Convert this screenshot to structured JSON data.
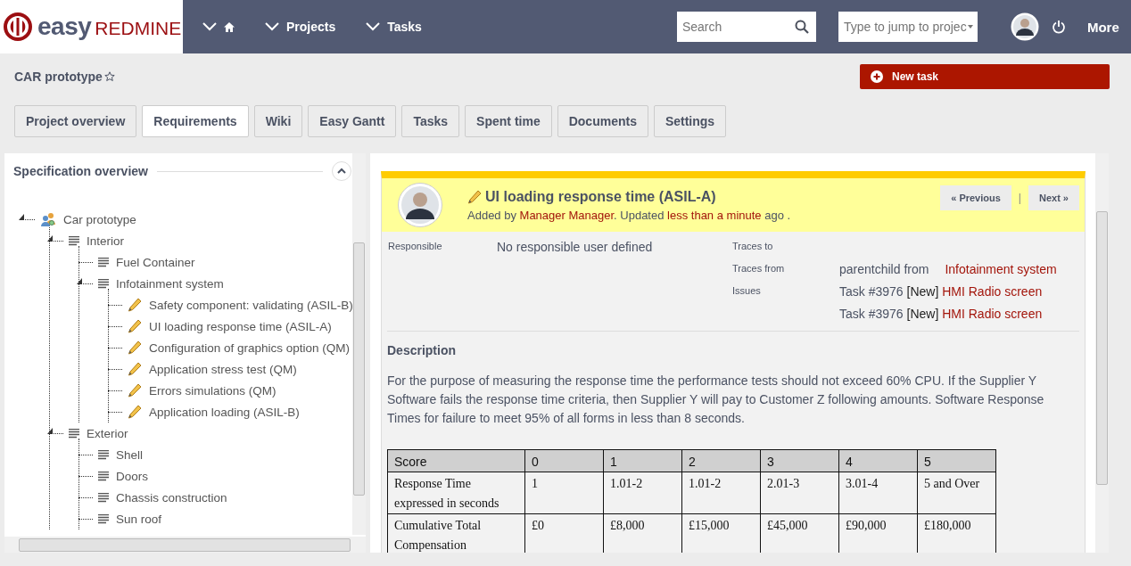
{
  "header": {
    "logo": {
      "word_1": "easy",
      "word_2": "REDMINE"
    },
    "nav": [
      {
        "kind": "home"
      },
      {
        "kind": "text",
        "label": "Projects"
      },
      {
        "kind": "text",
        "label": "Tasks"
      }
    ],
    "search": {
      "placeholder": "Search"
    },
    "jump": {
      "placeholder": "Type to jump to projec"
    },
    "more": "More"
  },
  "project_title": "CAR prototype",
  "new_task_button": "New task",
  "tabs": [
    {
      "label": "Project overview",
      "selected": false
    },
    {
      "label": "Requirements",
      "selected": true
    },
    {
      "label": "Wiki",
      "selected": false
    },
    {
      "label": "Easy Gantt",
      "selected": false
    },
    {
      "label": "Tasks",
      "selected": false
    },
    {
      "label": "Spent time",
      "selected": false
    },
    {
      "label": "Documents",
      "selected": false
    },
    {
      "label": "Settings",
      "selected": false
    }
  ],
  "sidebar": {
    "title": "Specification overview",
    "tree": [
      {
        "label": "Car prototype",
        "kind": "project",
        "expanded": true,
        "children": [
          {
            "label": "Interior",
            "kind": "folder",
            "expanded": true,
            "children": [
              {
                "label": "Fuel Container",
                "kind": "folder",
                "expanded": false
              },
              {
                "label": "Infotainment system",
                "kind": "folder",
                "expanded": true,
                "children": [
                  {
                    "label": "Safety component: validating (ASIL-B)",
                    "kind": "requirement",
                    "expanded": false
                  },
                  {
                    "label": "UI loading response time (ASIL-A)",
                    "kind": "requirement",
                    "expanded": false
                  },
                  {
                    "label": "Configuration of graphics option (QM)",
                    "kind": "requirement",
                    "expanded": false
                  },
                  {
                    "label": "Application stress test (QM)",
                    "kind": "requirement",
                    "expanded": false
                  },
                  {
                    "label": "Errors simulations (QM)",
                    "kind": "requirement",
                    "expanded": false
                  },
                  {
                    "label": "Application loading (ASIL-B)",
                    "kind": "requirement",
                    "expanded": false
                  }
                ]
              }
            ]
          },
          {
            "label": "Exterior",
            "kind": "folder",
            "expanded": true,
            "children": [
              {
                "label": "Shell",
                "kind": "folder",
                "expanded": false
              },
              {
                "label": "Doors",
                "kind": "folder",
                "expanded": false
              },
              {
                "label": "Chassis construction",
                "kind": "folder",
                "expanded": false
              },
              {
                "label": "Sun roof",
                "kind": "folder",
                "expanded": false
              }
            ]
          }
        ]
      }
    ]
  },
  "requirement": {
    "title": "UI loading response time (ASIL-A)",
    "added": {
      "prefix": "Added by",
      "author": "Manager Manager",
      "middle": ". Updated",
      "time": "less than a minute",
      "suffix": "ago ."
    },
    "previous_button": "« Previous",
    "separator": "|",
    "next_button": "Next »",
    "responsible": {
      "label": "Responsible",
      "value": "No responsible user defined"
    },
    "traces_to": {
      "label": "Traces to"
    },
    "traces_from": {
      "label": "Traces from",
      "text": "parentchild from",
      "link": "Infotainment system"
    },
    "issues": {
      "label": "Issues",
      "items": [
        {
          "task": "Task #3976",
          "status": "[New]",
          "title": "HMI Radio screen"
        },
        {
          "task": "Task #3976",
          "status": "[New]",
          "title": "HMI Radio screen"
        }
      ]
    },
    "description_heading": "Description",
    "description": "For the purpose of measuring the response time the performance tests should not exceed 60% CPU.  If the Supplier Y Software fails the response time criteria, then Supplier Y will pay to Customer Z following amounts. Software Response Times for failure to meet 95% of all forms in less than 8 seconds.",
    "table": {
      "columns": [
        "Score",
        "0",
        "1",
        "2",
        "3",
        "4",
        "5"
      ],
      "rows": [
        [
          "Response Time expressed in seconds",
          "1",
          "1.01-2",
          "1.01-2",
          "2.01-3",
          "3.01-4",
          "5 and Over"
        ],
        [
          "Cumulative Total Compensation",
          "£0",
          "£8,000",
          "£15,000",
          "£45,000",
          "£90,000",
          "£180,000"
        ]
      ]
    }
  }
}
